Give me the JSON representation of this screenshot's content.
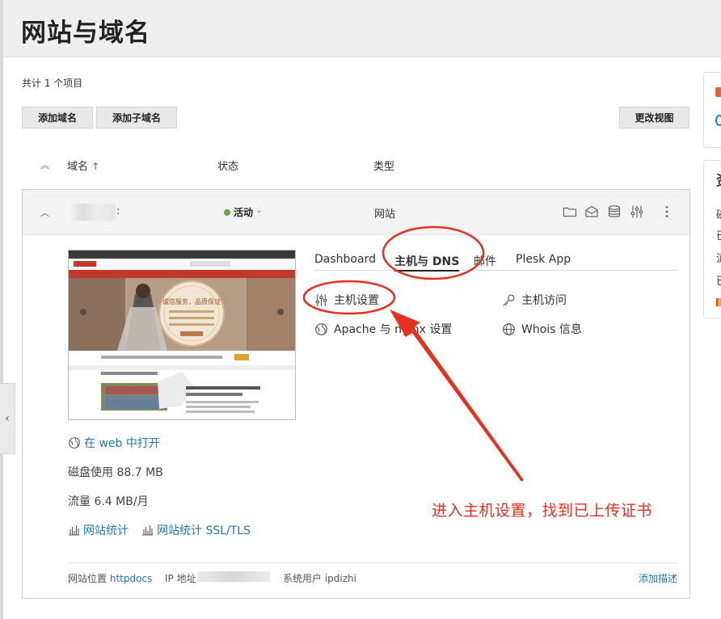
{
  "page": {
    "title": "网站与域名"
  },
  "list": {
    "count_text": "共计 1 个项目",
    "buttons": {
      "add_domain": "添加域名",
      "add_subdomain": "添加子域名",
      "change_view": "更改视图"
    },
    "columns": {
      "domain": "域名",
      "domain_sort": "↑",
      "status": "状态",
      "type": "类型"
    }
  },
  "domain": {
    "name_tail": ":",
    "status": "活动",
    "status_color": "#5cab2f",
    "type": "网站",
    "tabs": [
      {
        "label": "Dashboard"
      },
      {
        "label": "主机与 DNS"
      },
      {
        "label": "邮件"
      },
      {
        "label": "Plesk App"
      }
    ],
    "links": {
      "hosting_settings": "主机设置",
      "hosting_access": "主机访问",
      "apache_nginx": "Apache 与 nginx 设置",
      "whois": "Whois 信息"
    },
    "open_in_web": "在 web 中打开",
    "disk_usage": "磁盘使用 88.7 MB",
    "traffic": "流量 6.4 MB/月",
    "web_stats": "网站统计",
    "web_stats_ssl": "网站统计 SSL/TLS",
    "footer": {
      "location_label": "网站位置",
      "location_value": "httpdocs",
      "ip_label": "IP 地址",
      "system_user": "系统用户 ipdizhi",
      "add_description": "添加描述"
    },
    "thumbnail_banner": "诚信服务，品质保证 打造业界口碑最佳"
  },
  "right_panel": {
    "items": [
      "资",
      "磁",
      "已",
      "流",
      "已"
    ]
  },
  "annotation": {
    "text": "进入主机设置，找到已上传证书",
    "color": "#e8301f"
  },
  "icons": {
    "folder": "folder-icon",
    "mail": "mail-icon",
    "database": "database-icon",
    "settings": "sliders-icon",
    "more": "more-icon"
  }
}
